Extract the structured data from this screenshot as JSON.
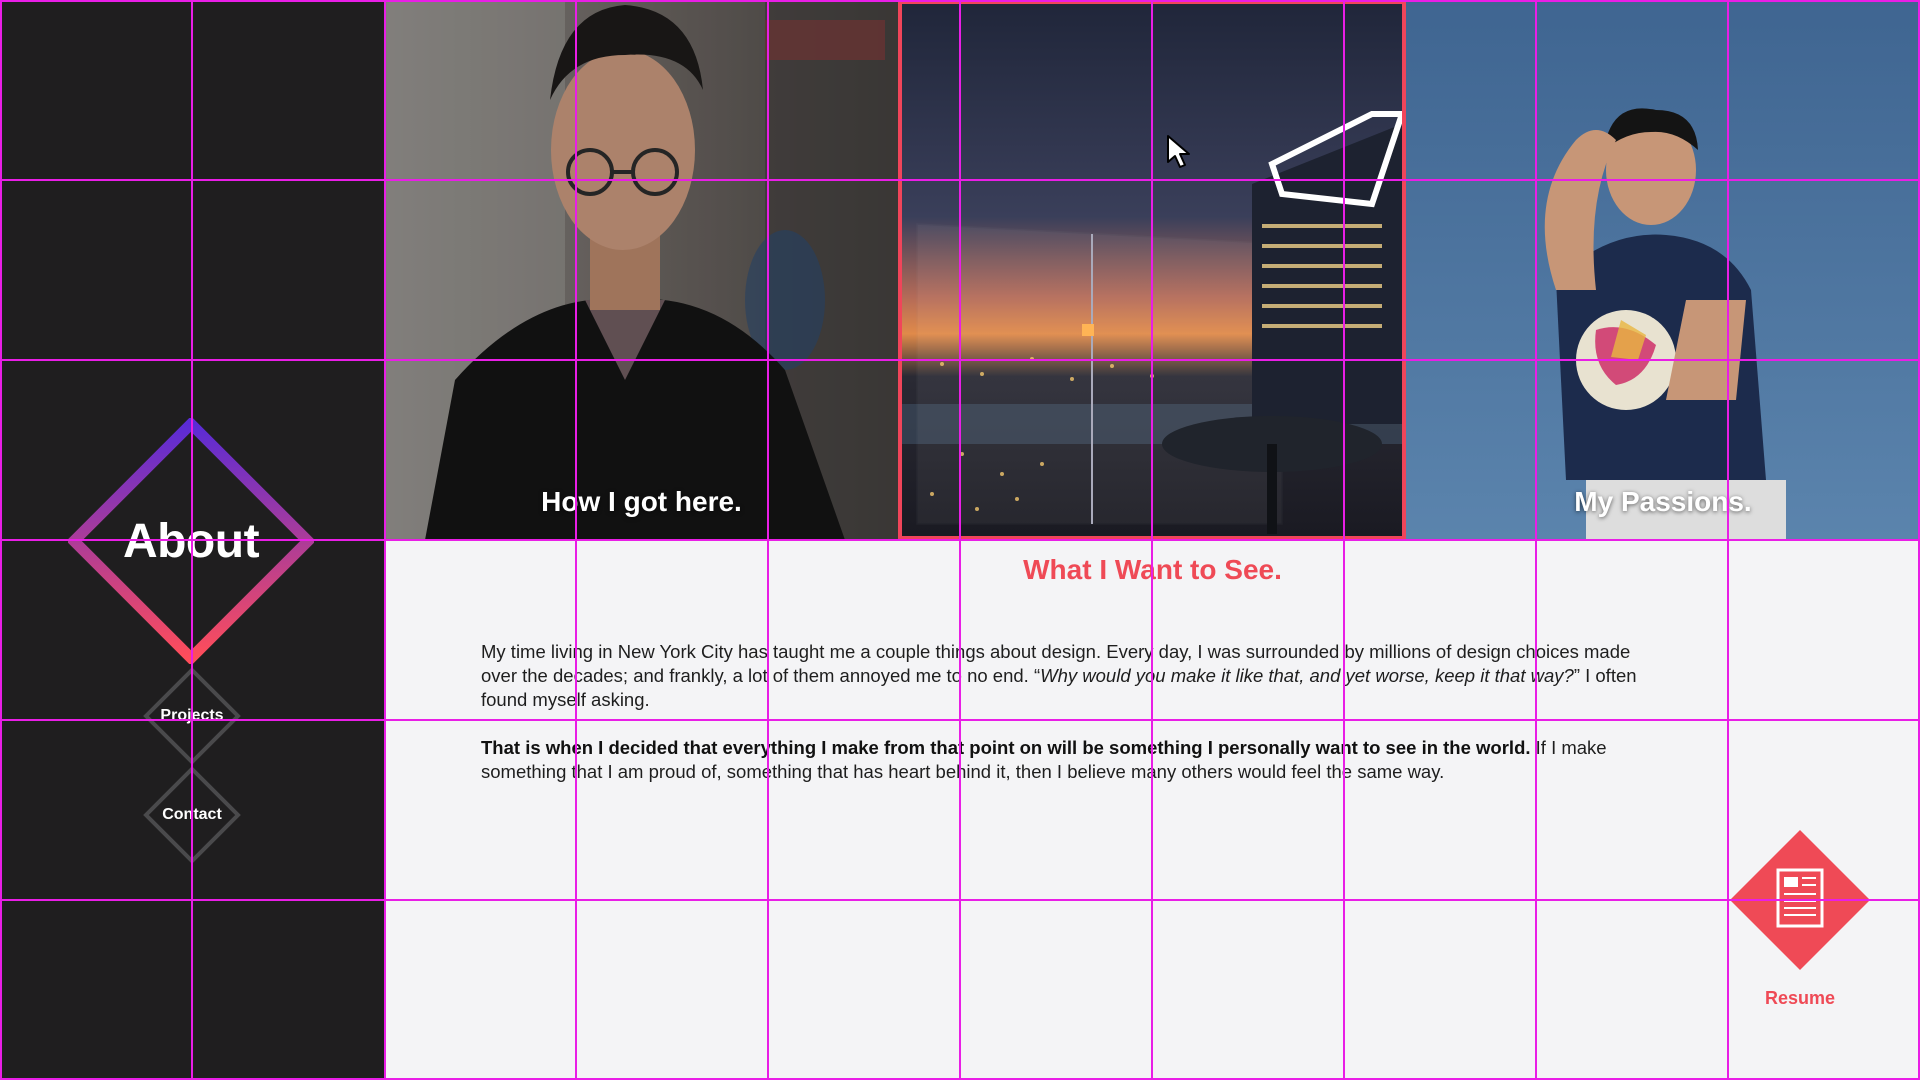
{
  "nav": {
    "about": "About",
    "projects": "Projects",
    "contact": "Contact"
  },
  "tiles": {
    "left": "How I got here.",
    "middle": "",
    "right": "My Passions."
  },
  "content": {
    "title": "What I Want to See.",
    "p1_a": "My time living in New York City has taught me a couple things about design. Every day, I was surrounded by millions of design choices made over the decades; and frankly, a lot of them annoyed me to no end. “",
    "p1_quote": "Why would you make it like that, and yet worse, keep it that way?",
    "p1_b": "” I often found myself asking.",
    "p2_bold": "That is when I decided that everything I make from that point on will be something I personally want to see in the world.",
    "p2_rest": " If I make something that I am proud of, something that has heart behind it, then I believe many others would feel the same way."
  },
  "resume": {
    "label": "Resume"
  },
  "colors": {
    "accent": "#ef4a56",
    "sidebar": "#1f1e1f",
    "panel": "#f4f4f6",
    "grid": "#e91ee6",
    "diamond_top": "#5a2bd6",
    "diamond_bottom": "#ff4d5a"
  },
  "icons": {
    "resume": "document-icon",
    "cursor": "mouse-pointer-icon"
  }
}
